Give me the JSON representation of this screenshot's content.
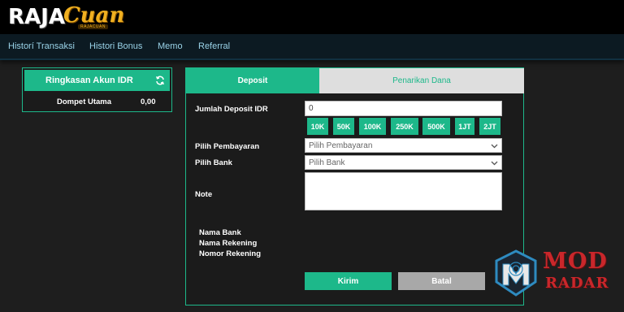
{
  "brand": {
    "logo_part1": "RAJA",
    "logo_part2": "Cuan",
    "logo_sub": "RAJACUAN"
  },
  "nav": {
    "items": [
      {
        "label": "Historí Transaksi"
      },
      {
        "label": "Histori Bonus"
      },
      {
        "label": "Memo"
      },
      {
        "label": "Referral"
      }
    ]
  },
  "account_summary": {
    "title": "Ringkasan Akun IDR",
    "wallet_label": "Dompet Utama",
    "wallet_value": "0,00",
    "refresh_icon": "refresh-icon"
  },
  "tabs": {
    "deposit": "Deposit",
    "withdraw": "Penarikan Dana",
    "active": "deposit"
  },
  "form": {
    "amount_label": "Jumlah Deposit IDR",
    "amount_value": "0",
    "quick_amounts": [
      "10K",
      "50K",
      "100K",
      "250K",
      "500K",
      "1JT",
      "2JT"
    ],
    "payment_label": "Pilih Pembayaran",
    "payment_selected": "Pilih Pembayaran",
    "bank_label": "Pilih Bank",
    "bank_selected": "Pilih Bank",
    "note_label": "Note",
    "note_value": ""
  },
  "bank_info": {
    "bank_name_label": "Nama Bank",
    "account_name_label": "Nama Rekening",
    "account_number_label": "Nomor Rekening"
  },
  "actions": {
    "submit": "Kirim",
    "cancel": "Batal"
  },
  "watermark": {
    "line1": "MOD",
    "line2": "RADAR"
  },
  "colors": {
    "accent": "#1db88a",
    "background": "#1e1e1e",
    "nav_text": "#9ad3e8",
    "logo_gold": "#f0b020",
    "watermark_red": "#c9272b",
    "tab_inactive": "#dedede",
    "cancel": "#a8a8a8"
  }
}
